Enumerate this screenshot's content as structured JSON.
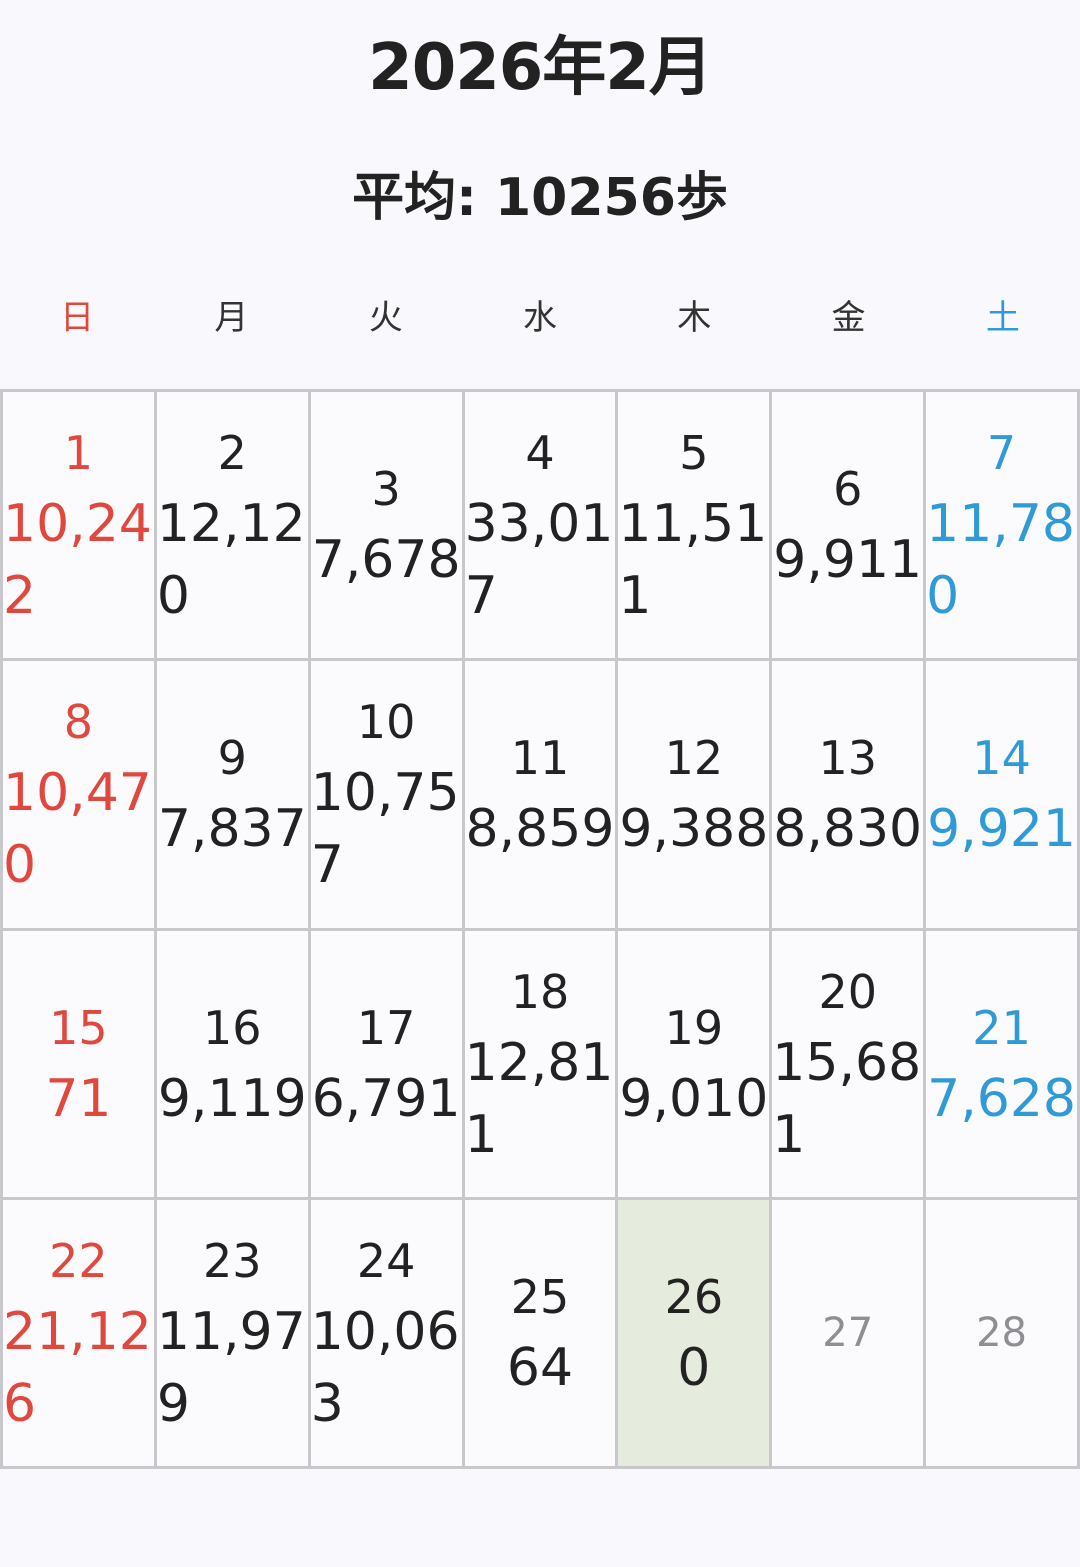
{
  "header": {
    "title": "2026年2月",
    "average": "平均: 10256歩"
  },
  "weekdays": [
    "日",
    "月",
    "火",
    "水",
    "木",
    "金",
    "土"
  ],
  "colors": {
    "sunday": "#e0473d",
    "saturday": "#2f9ad6",
    "today_background": "#e6ecdd",
    "future": "#8e8e93",
    "grid_line": "#c8c8cc"
  },
  "days": [
    {
      "day": "1",
      "steps": "10,242"
    },
    {
      "day": "2",
      "steps": "12,120"
    },
    {
      "day": "3",
      "steps": "7,678"
    },
    {
      "day": "4",
      "steps": "33,017"
    },
    {
      "day": "5",
      "steps": "11,511"
    },
    {
      "day": "6",
      "steps": "9,911"
    },
    {
      "day": "7",
      "steps": "11,780"
    },
    {
      "day": "8",
      "steps": "10,470"
    },
    {
      "day": "9",
      "steps": "7,837"
    },
    {
      "day": "10",
      "steps": "10,757"
    },
    {
      "day": "11",
      "steps": "8,859"
    },
    {
      "day": "12",
      "steps": "9,388"
    },
    {
      "day": "13",
      "steps": "8,830"
    },
    {
      "day": "14",
      "steps": "9,921"
    },
    {
      "day": "15",
      "steps": "71"
    },
    {
      "day": "16",
      "steps": "9,119"
    },
    {
      "day": "17",
      "steps": "6,791"
    },
    {
      "day": "18",
      "steps": "12,811"
    },
    {
      "day": "19",
      "steps": "9,010"
    },
    {
      "day": "20",
      "steps": "15,681"
    },
    {
      "day": "21",
      "steps": "7,628"
    },
    {
      "day": "22",
      "steps": "21,126"
    },
    {
      "day": "23",
      "steps": "11,979"
    },
    {
      "day": "24",
      "steps": "10,063"
    },
    {
      "day": "25",
      "steps": "64"
    },
    {
      "day": "26",
      "steps": "0",
      "today": true
    },
    {
      "day": "27",
      "steps": "",
      "future": true
    },
    {
      "day": "28",
      "steps": "",
      "future": true
    }
  ]
}
